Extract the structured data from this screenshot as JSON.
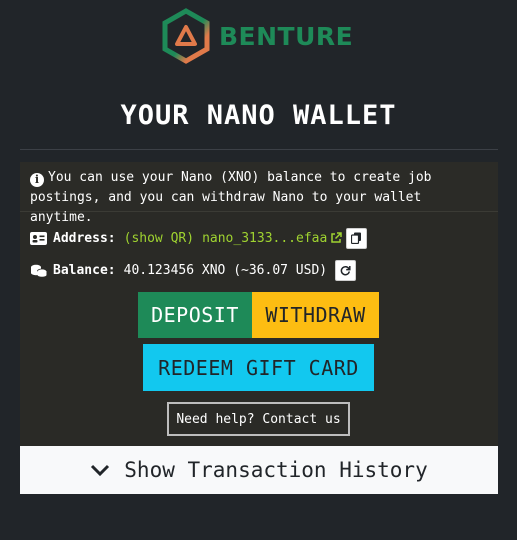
{
  "brand": {
    "name": "BENTURE",
    "logo_icon": "benture-hexagon-logo"
  },
  "page_title": "YOUR NANO WALLET",
  "info": {
    "icon": "info-circle-icon",
    "text": "You can use your Nano (XNO) balance to create job postings, and you can withdraw Nano to your wallet anytime."
  },
  "address": {
    "icon": "id-card-icon",
    "label": "Address:",
    "show_qr": "(show QR)",
    "value": "nano_3133...efaa",
    "link_icon": "external-link-icon",
    "copy_icon": "copy-icon"
  },
  "balance": {
    "icon": "coins-icon",
    "label": "Balance:",
    "value": "40.123456 XNO (~36.07 USD)",
    "refresh_icon": "refresh-icon"
  },
  "buttons": {
    "deposit": "DEPOSIT",
    "withdraw": "WITHDRAW",
    "redeem": "REDEEM GIFT CARD",
    "help": "Need help? Contact us"
  },
  "history": {
    "label": "Show Transaction History",
    "icon": "chevron-down-icon"
  },
  "colors": {
    "background": "#212529",
    "brand_green": "#1e8a58",
    "logo_orange": "#e07a4a",
    "link_green": "#9fd330",
    "withdraw_yellow": "#fdbd12",
    "redeem_cyan": "#12c8ef"
  }
}
